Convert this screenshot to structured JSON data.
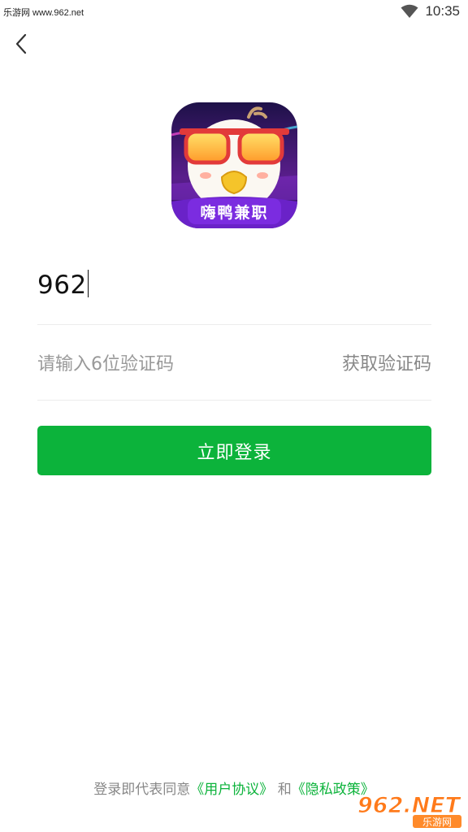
{
  "status_bar": {
    "site_text": "乐游网 www.962.net",
    "time": "10:35",
    "wifi_icon": "wifi-icon"
  },
  "header": {
    "back_icon": "chevron-left-icon"
  },
  "logo": {
    "app_name": "嗨鸭兼职"
  },
  "form": {
    "phone_value": "962",
    "code_placeholder": "请输入6位验证码",
    "get_code_label": "获取验证码",
    "login_label": "立即登录"
  },
  "agreement": {
    "prefix": "登录即代表同意",
    "user_agreement": "《用户协议》",
    "joiner": " 和",
    "privacy_policy": "《隐私政策》"
  },
  "watermark": {
    "brand": "962.NET",
    "site": "乐游网"
  },
  "colors": {
    "accent": "#0cb33b",
    "placeholder": "#999999",
    "divider": "#ececec"
  }
}
